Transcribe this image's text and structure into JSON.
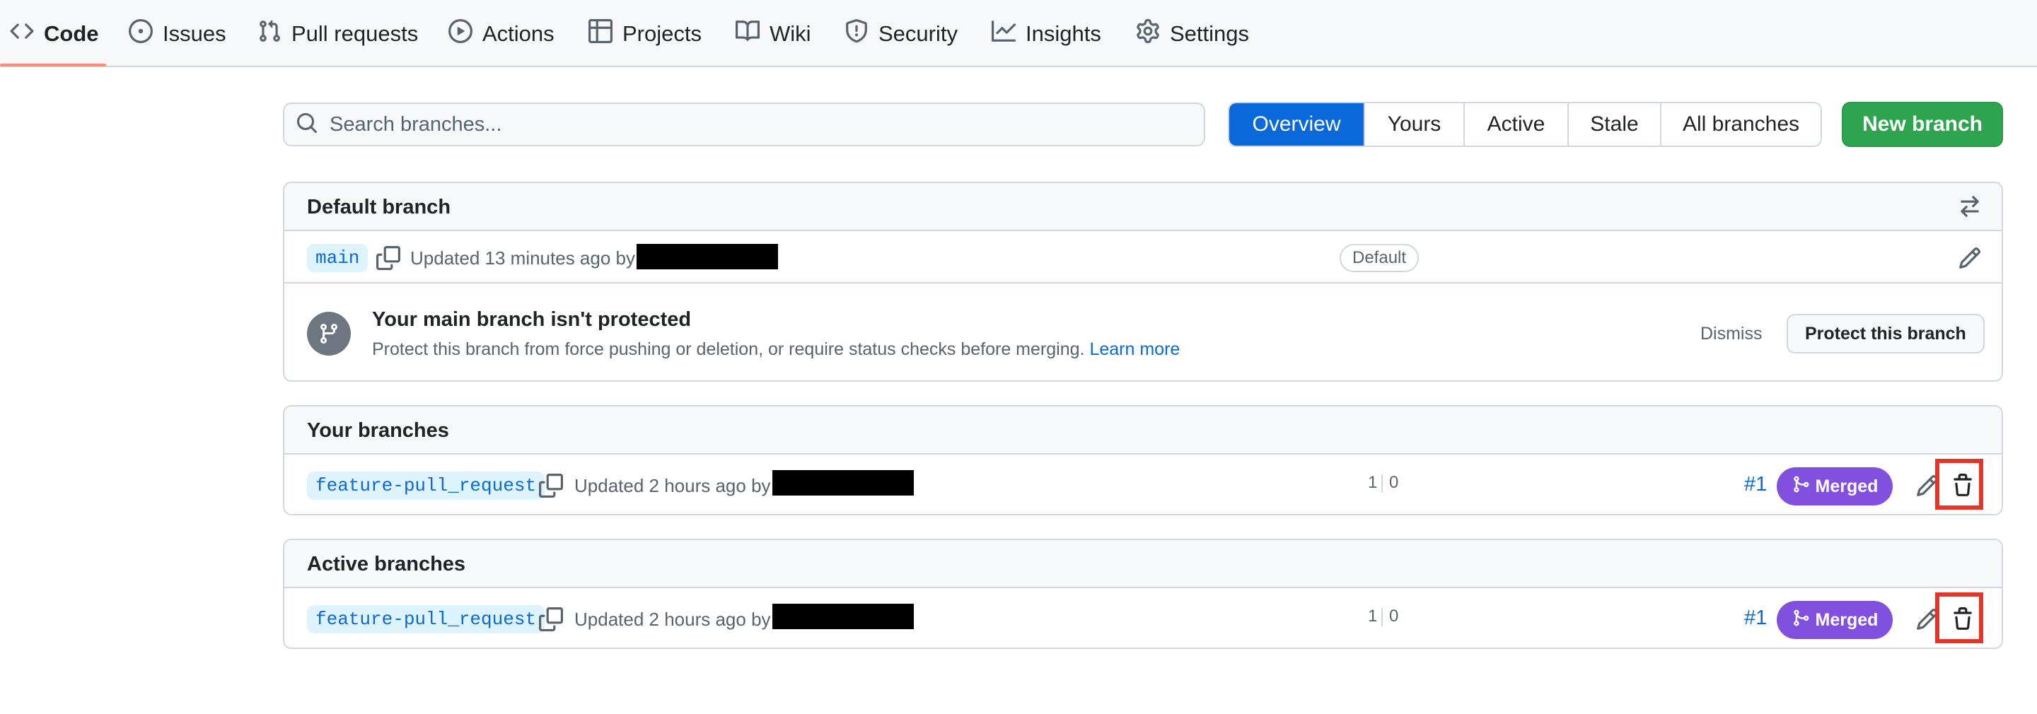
{
  "nav": {
    "tabs": [
      {
        "label": "Code",
        "icon": "code-icon",
        "selected": true
      },
      {
        "label": "Issues",
        "icon": "issue-opened-icon"
      },
      {
        "label": "Pull requests",
        "icon": "git-pull-request-icon"
      },
      {
        "label": "Actions",
        "icon": "play-icon"
      },
      {
        "label": "Projects",
        "icon": "table-icon"
      },
      {
        "label": "Wiki",
        "icon": "book-icon"
      },
      {
        "label": "Security",
        "icon": "shield-icon"
      },
      {
        "label": "Insights",
        "icon": "graph-icon"
      },
      {
        "label": "Settings",
        "icon": "gear-icon"
      }
    ],
    "selected_color": "#fd8c73"
  },
  "search": {
    "placeholder": "Search branches..."
  },
  "filters": {
    "tabs": [
      "Overview",
      "Yours",
      "Active",
      "Stale",
      "All branches"
    ],
    "active": "Overview"
  },
  "new_branch_label": "New branch",
  "default_section": {
    "title": "Default branch",
    "branch": {
      "name": "main",
      "updated": "Updated 13 minutes ago by",
      "badge": "Default"
    },
    "protection": {
      "title": "Your main branch isn't protected",
      "description": "Protect this branch from force pushing or deletion, or require status checks before merging.",
      "learn_more": "Learn more",
      "dismiss": "Dismiss",
      "protect_button": "Protect this branch"
    }
  },
  "your_section": {
    "title": "Your branches",
    "branch": {
      "name": "feature-pull_request",
      "updated": "Updated 2 hours ago by",
      "ahead": "1",
      "behind": "0",
      "pr": "#1",
      "status": "Merged"
    }
  },
  "active_section": {
    "title": "Active branches",
    "branch": {
      "name": "feature-pull_request",
      "updated": "Updated 2 hours ago by",
      "ahead": "1",
      "behind": "0",
      "pr": "#1",
      "status": "Merged"
    }
  },
  "colors": {
    "accent": "#0969da",
    "success": "#2da44e",
    "merged": "#8250df",
    "highlight": "#e3352a"
  }
}
